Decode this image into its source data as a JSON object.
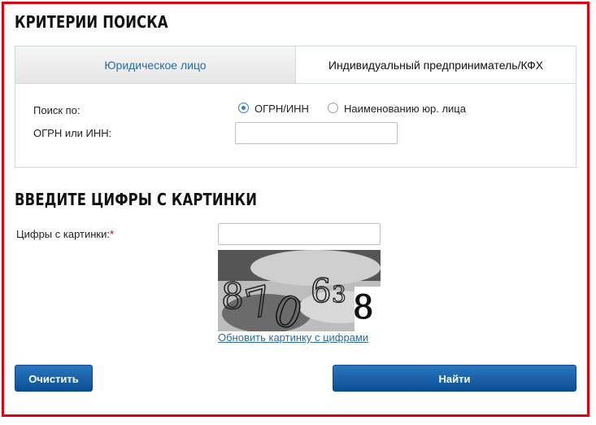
{
  "sections": {
    "criteria_title": "КРИТЕРИИ ПОИСКА",
    "captcha_title": "ВВЕДИТЕ ЦИФРЫ С КАРТИНКИ"
  },
  "tabs": [
    {
      "label": "Юридическое лицо",
      "active": true
    },
    {
      "label": "Индивидуальный предприниматель/КФХ",
      "active": false
    }
  ],
  "search": {
    "search_by_label": "Поиск по:",
    "options": [
      {
        "label": "ОГРН/ИНН",
        "checked": true
      },
      {
        "label": "Наименованию юр. лица",
        "checked": false
      }
    ],
    "field_label": "ОГРН или ИНН:",
    "field_value": ""
  },
  "captcha": {
    "label": "Цифры с картинки:",
    "required_mark": "*",
    "input_value": "",
    "digits": [
      "8",
      "7",
      "0",
      "6",
      "3",
      "8"
    ],
    "refresh_link": "Обновить картинку с цифрами"
  },
  "buttons": {
    "clear": "Очистить",
    "find": "Найти"
  },
  "colors": {
    "frame": "#e3000f",
    "accent": "#2a6aa1",
    "button": "#0b4f94"
  }
}
